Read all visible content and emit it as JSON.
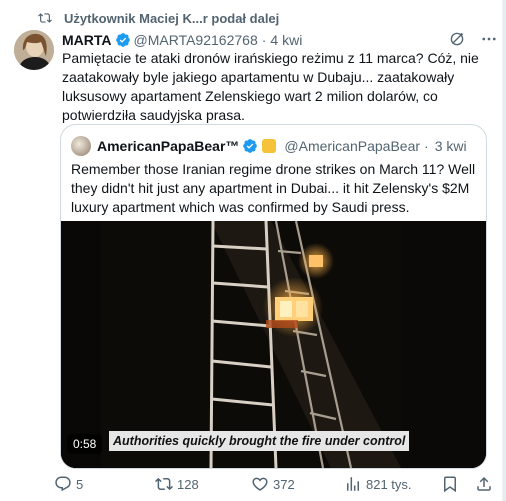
{
  "repost": {
    "text": "Użytkownik Maciej K...r podał dalej",
    "icon": "repost-icon"
  },
  "tweet": {
    "author_name": "MARTA",
    "handle": "@MARTA92162768",
    "time": "4 kwi",
    "separator": "·",
    "text": "Pamiętacie te ataki dronów irańskiego reżimu z 11 marca? Cóż, nie zaatakowały byle jakiego apartamentu w Dubaju... zaatakowały luksusowy apartament Zelenskiego wart 2 milion dolarów, co potwierdziła saudyjska prasa."
  },
  "quote": {
    "author_name": "AmericanPapaBear™",
    "handle": "@AmericanPapaBear",
    "time": "3 kwi",
    "separator": "·",
    "text": "Remember those Iranian regime drone strikes on March 11? Well they didn't hit just any apartment in Dubai... it hit Zelensky's $2M luxury apartment which was confirmed by Saudi press.",
    "video": {
      "duration": "0:58",
      "caption": "Authorities quickly brought the fire under control"
    }
  },
  "actions": {
    "replies": "5",
    "reposts": "128",
    "likes": "372",
    "views": "821 tys."
  },
  "colors": {
    "accent": "#1d9bf0",
    "muted": "#536471",
    "text": "#0f1419",
    "border": "#cfd9de"
  }
}
